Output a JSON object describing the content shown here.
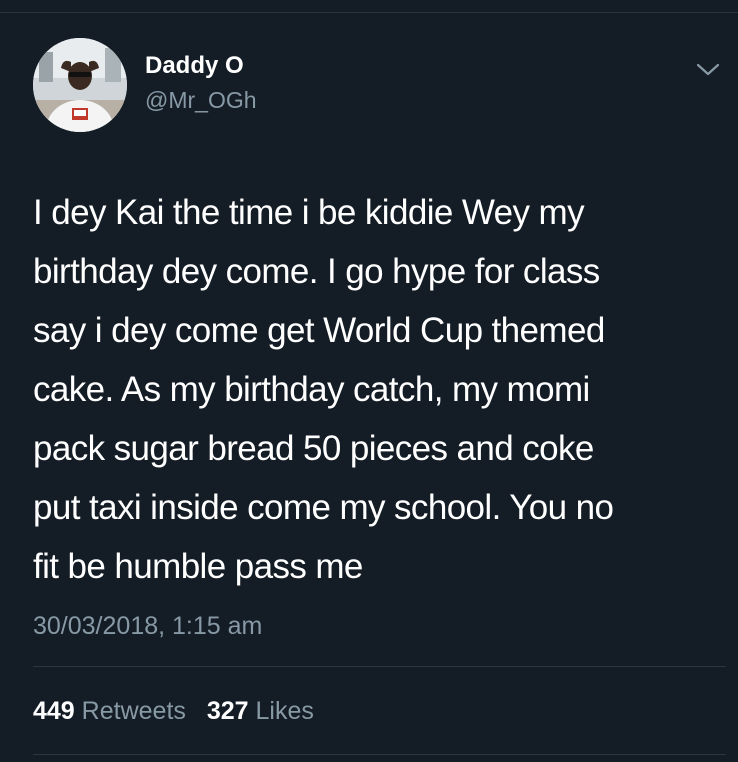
{
  "tweet": {
    "author": {
      "display_name": "Daddy O",
      "handle": "@Mr_OGh",
      "avatar_icon": "avatar-photo"
    },
    "text": "I dey Kai the time i be kiddie Wey my\nbirthday dey come. I go hype for class\nsay i dey come get World Cup themed\ncake. As my birthday catch, my momi\npack sugar bread 50 pieces and coke\nput taxi inside come my school. You no\nfit be humble pass me",
    "timestamp": "30/03/2018, 1:15 am",
    "retweets": {
      "count": "449",
      "label": "Retweets"
    },
    "likes": {
      "count": "327",
      "label": "Likes"
    },
    "menu_icon": "chevron-down-icon"
  },
  "colors": {
    "background": "#141d26",
    "primary_text": "#ffffff",
    "secondary_text": "#8899a6",
    "divider": "#2a3540"
  }
}
